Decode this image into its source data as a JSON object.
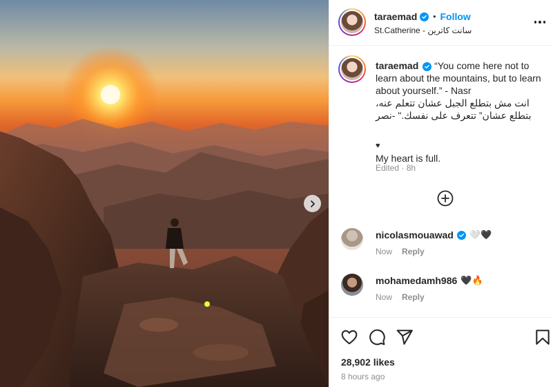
{
  "post": {
    "username": "taraemad",
    "follow_label": "Follow",
    "separator": "•",
    "location": "St.Catherine - سانت كاترين",
    "caption_en": "“You come here not to learn about the mountains, but to learn about yourself.” - Nasr",
    "caption_ar": "انت مش بتطلع الجبل عشان تتعلم عنه، بتطلع عشان” تتعرف على نفسك.\" -نصر",
    "heart": "♥",
    "caption_extra": "My heart is full.",
    "edited": "Edited · 8h",
    "likes": "28,902 likes",
    "time": "8 hours ago"
  },
  "comments": [
    {
      "username": "nicolasmouawad",
      "emoji": "🤍🖤",
      "time": "Now",
      "reply_label": "Reply"
    },
    {
      "username": "mohamedamh986",
      "emoji": "🖤🔥",
      "time": "Now",
      "reply_label": "Reply"
    }
  ],
  "icons": {
    "header_more": "more-options-icon",
    "verified": "verified-badge-icon",
    "next": "chevron-right-icon",
    "add": "add-circle-icon",
    "like": "heart-outline-icon",
    "comment": "comment-icon",
    "share": "send-icon",
    "save": "bookmark-icon"
  },
  "colors": {
    "accent": "#0095f6",
    "text": "#262626",
    "muted": "#8e8e8e"
  }
}
